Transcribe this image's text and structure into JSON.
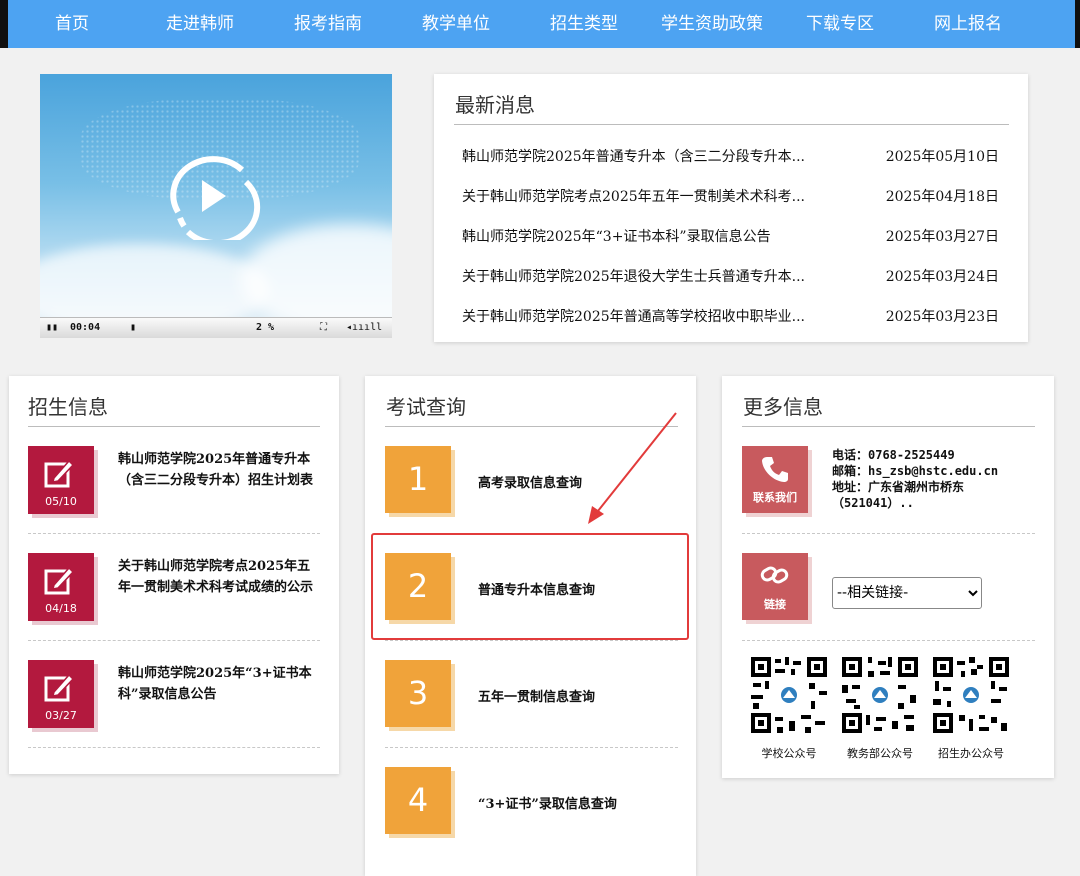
{
  "nav": [
    "首页",
    "走进韩师",
    "报考指南",
    "教学单位",
    "招生类型",
    "学生资助政策",
    "下载专区",
    "网上报名"
  ],
  "video": {
    "time": "00:04",
    "percent": "2 %"
  },
  "news": {
    "title": "最新消息",
    "items": [
      {
        "title": "韩山师范学院2025年普通专升本（含三二分段专升本...",
        "date": "2025年05月10日"
      },
      {
        "title": "关于韩山师范学院考点2025年五年一贯制美术术科考...",
        "date": "2025年04月18日"
      },
      {
        "title": "韩山师范学院2025年“3+证书本科”录取信息公告",
        "date": "2025年03月27日"
      },
      {
        "title": "关于韩山师范学院2025年退役大学生士兵普通专升本...",
        "date": "2025年03月24日"
      },
      {
        "title": "关于韩山师范学院2025年普通高等学校招收中职毕业...",
        "date": "2025年03月23日"
      }
    ]
  },
  "admissions": {
    "title": "招生信息",
    "items": [
      {
        "date": "05/10",
        "text": "韩山师范学院2025年普通专升本（含三二分段专升本）招生计划表"
      },
      {
        "date": "04/18",
        "text": "关于韩山师范学院考点2025年五年一贯制美术术科考试成绩的公示"
      },
      {
        "date": "03/27",
        "text": "韩山师范学院2025年“3+证书本科”录取信息公告"
      }
    ]
  },
  "query": {
    "title": "考试查询",
    "items": [
      {
        "num": "1",
        "text": "高考录取信息查询"
      },
      {
        "num": "2",
        "text": "普通专升本信息查询"
      },
      {
        "num": "3",
        "text": "五年一贯制信息查询"
      },
      {
        "num": "4",
        "text": "“3+证书”录取信息查询"
      }
    ]
  },
  "more": {
    "title": "更多信息",
    "contact_label": "联系我们",
    "phone": "电话：0768-2525449",
    "email": "邮箱：hs_zsb@hstc.edu.cn",
    "address1": "地址：广东省潮州市桥东",
    "address2": "（521041）..",
    "link_label": "链接",
    "select_value": "--相关链接-",
    "qr_labels": [
      "学校公众号",
      "教务部公众号",
      "招生办公众号"
    ]
  },
  "colors": {
    "nav": "#4da3f2",
    "admissions_icon": "#b3193e",
    "query_icon": "#f0a33a",
    "more_icon": "#c85a5e",
    "annotation": "#e23b3b"
  }
}
